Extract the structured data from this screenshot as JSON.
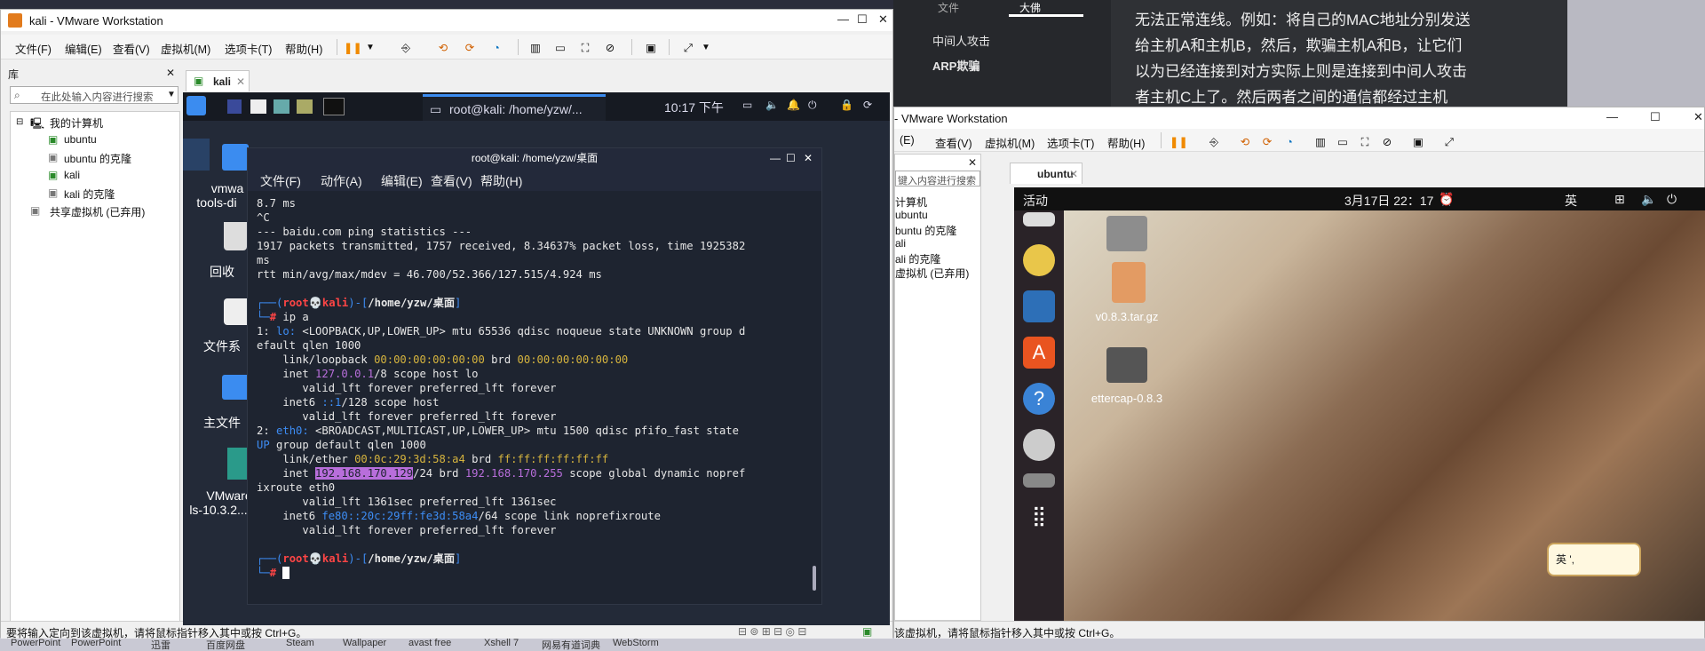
{
  "article": {
    "tab_file": "文件",
    "tab_active": "大佛",
    "nav_item1": "中间人攻击",
    "nav_item2": "ARP欺骗",
    "paragraph": "无法正常连线。例如：将自己的MAC地址分别发送给主机A和主机B，然后，欺骗主机A和B，让它们以为已经连接到对方实际上则是连接到中间人攻击者主机C上了。然后两者之间的通信都经过主机C。"
  },
  "taskbar": {
    "items": [
      "PowerPoint",
      "PowerPoint",
      "迅雷",
      "百度网盘",
      "Steam",
      "Wallpaper",
      "avast free",
      "Xshell 7",
      "网易有道词典",
      "WebStorm"
    ]
  },
  "kali_window": {
    "title": "kali - VMware Workstation",
    "menu": [
      "文件(F)",
      "编辑(E)",
      "查看(V)",
      "虚拟机(M)",
      "选项卡(T)",
      "帮助(H)"
    ],
    "library_title": "库",
    "search_placeholder": "在此处输入内容进行搜索",
    "tree": {
      "root": "我的计算机",
      "items": [
        "ubuntu",
        "ubuntu 的克隆",
        "kali",
        "kali 的克隆"
      ],
      "shared": "共享虚拟机 (已弃用)"
    },
    "tab_label": "kali",
    "status_text": "要将输入定向到该虚拟机，请将鼠标指针移入其中或按 Ctrl+G。"
  },
  "kali_guest": {
    "clock": "10:17 下午",
    "task_label": "root@kali: /home/yzw/...",
    "desktop_icons": [
      "vmware-tools-distrib",
      "回收站",
      "文件系统",
      "主文件夹",
      "VMware Tools-10.3.22-..."
    ],
    "desktop_icon_labels_visible": [
      "vmwa",
      "tools-di",
      "回收",
      "文件系",
      "主文件",
      "VMware",
      "ls-10.3.2..."
    ]
  },
  "terminal": {
    "title": "root@kali: /home/yzw/桌面",
    "menu": [
      "文件(F)",
      "动作(A)",
      "编辑(E)",
      "查看(V)",
      "帮助(H)"
    ],
    "lines": {
      "l1": "8.7 ms",
      "l2": "^C",
      "l3": "--- baidu.com ping statistics ---",
      "l4": "1917 packets transmitted, 1757 received, 8.34637% packet loss, time 1925382",
      "l5": "ms",
      "l6": "rtt min/avg/max/mdev = 46.700/52.366/127.515/4.924 ms",
      "prompt_user": "root",
      "prompt_host": "kali",
      "prompt_path": "/home/yzw/桌面",
      "cmd": "ip a",
      "ip": "192.168.170.129",
      "brd_ip": "192.168.170.255",
      "mac": "00:0c:29:3d:58:a4",
      "ipv6": "fe80::20c:29ff:fe3d:58a4"
    }
  },
  "ubuntu_window": {
    "title": "- VMware Workstation",
    "menu": [
      "(E)",
      "查看(V)",
      "虚拟机(M)",
      "选项卡(T)",
      "帮助(H)"
    ],
    "search_placeholder": "键入内容进行搜索",
    "tree": [
      "计算机",
      "ubuntu",
      "buntu 的克隆",
      "ali",
      "ali 的克隆",
      "虚拟机 (已弃用)"
    ],
    "tab_label": "ubuntu",
    "status_text": "该虚拟机，请将鼠标指针移入其中或按 Ctrl+G。"
  },
  "ubuntu_guest": {
    "activities": "活动",
    "clock": "3月17日 22：17",
    "ime": "英",
    "icons": [
      "Home",
      "v0.8.3.tar.gz",
      "ettercap-0.8.3"
    ],
    "ime_widget": "英 ',"
  }
}
